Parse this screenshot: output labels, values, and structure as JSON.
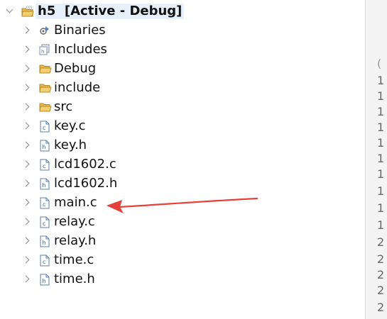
{
  "project": {
    "name": "h5",
    "config": "[Active - Debug]"
  },
  "tree_items": [
    {
      "label": "Binaries",
      "icon": "binaries-icon"
    },
    {
      "label": "Includes",
      "icon": "includes-icon"
    },
    {
      "label": "Debug",
      "icon": "folder-icon"
    },
    {
      "label": "include",
      "icon": "folder-icon"
    },
    {
      "label": "src",
      "icon": "folder-icon"
    },
    {
      "label": "key.c",
      "icon": "c-source-file-icon"
    },
    {
      "label": "key.h",
      "icon": "c-header-file-icon"
    },
    {
      "label": "lcd1602.c",
      "icon": "c-source-file-icon"
    },
    {
      "label": "lcd1602.h",
      "icon": "c-header-file-icon"
    },
    {
      "label": "main.c",
      "icon": "c-source-file-icon"
    },
    {
      "label": "relay.c",
      "icon": "c-source-file-icon"
    },
    {
      "label": "relay.h",
      "icon": "c-header-file-icon"
    },
    {
      "label": "time.c",
      "icon": "c-source-file-icon"
    },
    {
      "label": "time.h",
      "icon": "c-header-file-icon"
    }
  ],
  "gutter": {
    "top_fragments": [
      "",
      "",
      "("
    ],
    "line_numbers": [
      "1",
      "1",
      "1",
      "1",
      "1",
      "1",
      "1",
      "1",
      "1",
      "1",
      "2",
      "2",
      "2",
      "2",
      "2"
    ]
  },
  "annotation": {
    "type": "red-arrow",
    "color": "#e8403a",
    "points_to": "main.c"
  },
  "colors": {
    "selection": "#e6f0fa",
    "folder": "#e8b94c",
    "file_border": "#5b7fa8",
    "gutter_bg": "#f4f4f4"
  }
}
